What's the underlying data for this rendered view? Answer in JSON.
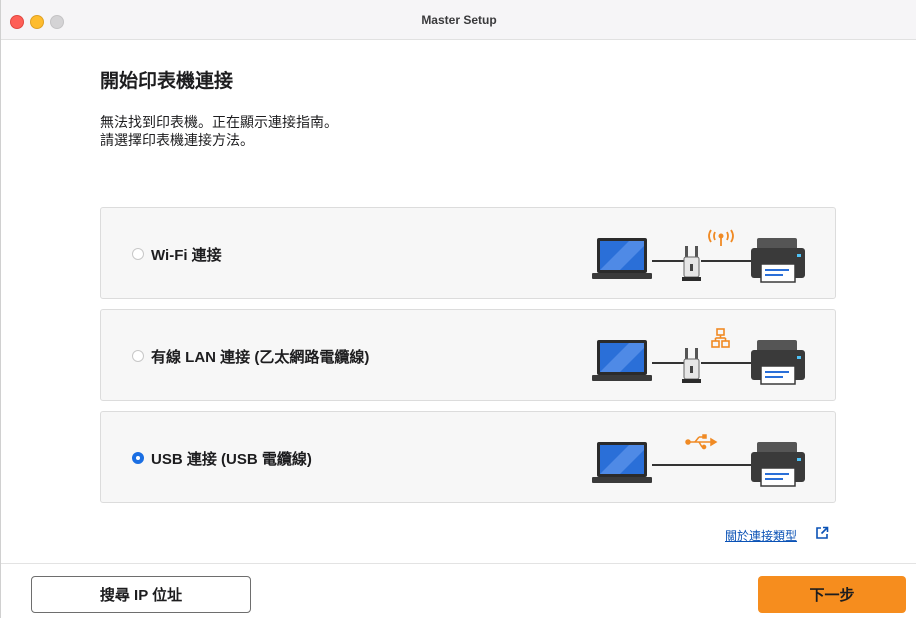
{
  "window": {
    "title": "Master Setup"
  },
  "heading": "開始印表機連接",
  "description": [
    "無法找到印表機。正在顯示連接指南。",
    "請選擇印表機連接方法。"
  ],
  "options": [
    {
      "label": "Wi-Fi 連接",
      "selected": false,
      "illustration": "laptop-router-wifi-printer"
    },
    {
      "label": "有線 LAN 連接 (乙太網路電纜線)",
      "selected": false,
      "illustration": "laptop-router-lan-printer"
    },
    {
      "label": "USB 連接 (USB 電纜線)",
      "selected": true,
      "illustration": "laptop-usb-printer"
    }
  ],
  "help_link": {
    "label": "關於連接類型",
    "icon": "external-link-icon"
  },
  "footer": {
    "search_ip_label": "搜尋 IP 位址",
    "next_label": "下一步"
  },
  "colors": {
    "accent": "#f68d1e",
    "radio_selected": "#1b6fe3",
    "link": "#0a52b6",
    "icon_orange": "#f08a24"
  }
}
